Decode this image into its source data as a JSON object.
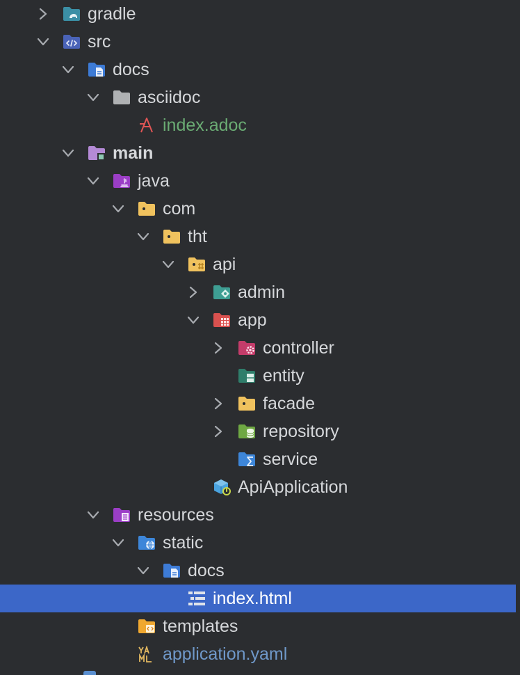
{
  "tree": {
    "items": [
      {
        "label": "gradle",
        "expanded": false,
        "icon": "gradle-folder-icon"
      },
      {
        "label": "src",
        "expanded": true,
        "icon": "source-folder-icon"
      },
      {
        "label": "docs",
        "expanded": true,
        "icon": "docs-folder-icon"
      },
      {
        "label": "asciidoc",
        "expanded": true,
        "icon": "folder-icon"
      },
      {
        "label": "index.adoc",
        "icon": "asciidoc-file-icon",
        "color": "#6aab73"
      },
      {
        "label": "main",
        "expanded": true,
        "icon": "module-folder-icon"
      },
      {
        "label": "java",
        "expanded": true,
        "icon": "java-source-folder-icon"
      },
      {
        "label": "com",
        "expanded": true,
        "icon": "package-icon"
      },
      {
        "label": "tht",
        "expanded": true,
        "icon": "package-icon"
      },
      {
        "label": "api",
        "expanded": true,
        "icon": "package-icon"
      },
      {
        "label": "admin",
        "expanded": false,
        "icon": "admin-package-icon"
      },
      {
        "label": "app",
        "expanded": true,
        "icon": "app-package-icon"
      },
      {
        "label": "controller",
        "expanded": false,
        "icon": "controller-package-icon"
      },
      {
        "label": "entity",
        "icon": "entity-package-icon"
      },
      {
        "label": "facade",
        "expanded": false,
        "icon": "package-icon"
      },
      {
        "label": "repository",
        "expanded": false,
        "icon": "repository-package-icon"
      },
      {
        "label": "service",
        "icon": "service-package-icon"
      },
      {
        "label": "ApiApplication",
        "icon": "spring-boot-application-icon"
      },
      {
        "label": "resources",
        "expanded": true,
        "icon": "resources-folder-icon"
      },
      {
        "label": "static",
        "expanded": true,
        "icon": "web-folder-icon"
      },
      {
        "label": "docs",
        "expanded": true,
        "icon": "docs-folder-icon"
      },
      {
        "label": "index.html",
        "icon": "html-file-icon",
        "selected": true
      },
      {
        "label": "templates",
        "icon": "templates-folder-icon"
      },
      {
        "label": "application.yaml",
        "icon": "yaml-file-icon",
        "color": "#6f98c9"
      }
    ]
  },
  "colors": {
    "background": "#2b2d30",
    "selection": "#3c67c8",
    "text": "#d5d7da",
    "green_text": "#6aab73",
    "blue_text": "#6f98c9"
  }
}
